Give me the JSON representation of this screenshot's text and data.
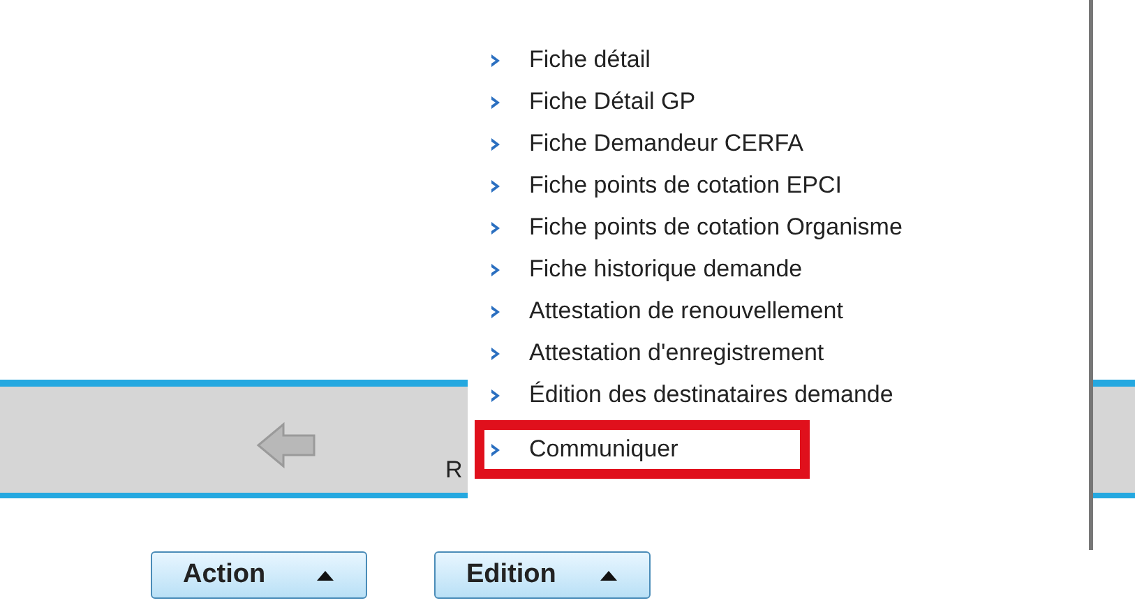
{
  "toolbar": {
    "label": "R"
  },
  "menu": {
    "items": [
      {
        "label": "Fiche détail",
        "highlighted": false
      },
      {
        "label": "Fiche Détail GP",
        "highlighted": false
      },
      {
        "label": "Fiche Demandeur CERFA",
        "highlighted": false
      },
      {
        "label": "Fiche points de cotation EPCI",
        "highlighted": false
      },
      {
        "label": "Fiche points de cotation Organisme",
        "highlighted": false
      },
      {
        "label": "Fiche historique demande",
        "highlighted": false
      },
      {
        "label": "Attestation de renouvellement",
        "highlighted": false
      },
      {
        "label": "Attestation d'enregistrement",
        "highlighted": false
      },
      {
        "label": "Édition des destinataires demande",
        "highlighted": false
      },
      {
        "label": "Communiquer",
        "highlighted": true
      }
    ]
  },
  "buttons": [
    {
      "label": "Action"
    },
    {
      "label": "Edition"
    }
  ]
}
